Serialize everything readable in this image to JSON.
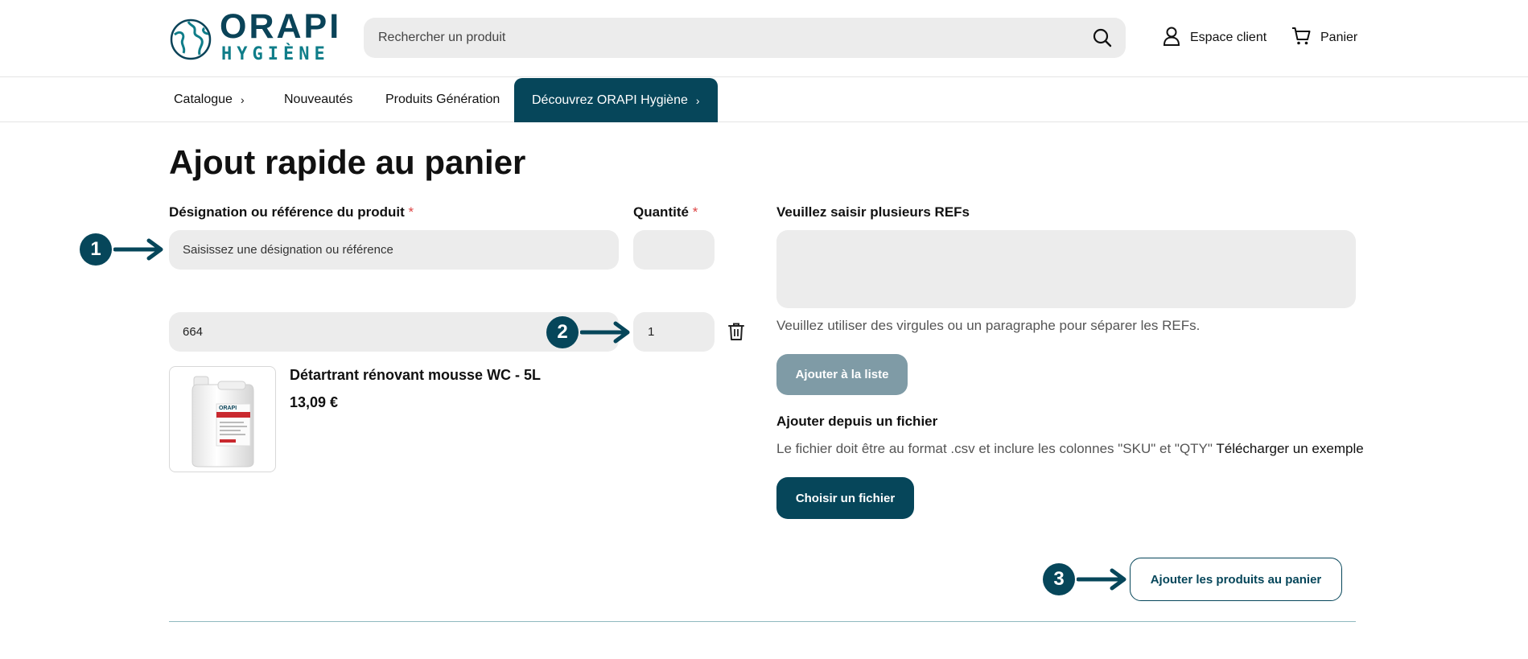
{
  "header": {
    "logo_top": "ORAPI",
    "logo_bottom": "HYGIÈNE",
    "search_placeholder": "Rechercher un produit",
    "account_label": "Espace client",
    "cart_label": "Panier"
  },
  "nav": {
    "items": [
      {
        "label": "Catalogue",
        "chevron": "›"
      },
      {
        "label": "Nouveautés"
      },
      {
        "label": "Produits Génération"
      },
      {
        "label": "Découvrez ORAPI Hygiène",
        "chevron": "›"
      }
    ]
  },
  "main": {
    "title": "Ajout rapide au panier",
    "designation_label": "Désignation ou référence du produit",
    "quantity_label": "Quantité",
    "required_mark": "*",
    "designation_placeholder": "Saisissez une désignation ou référence",
    "quantity_value": "",
    "row": {
      "reference": "664",
      "quantity": "1",
      "product_name": "Détartrant rénovant mousse WC - 5L",
      "price": "13,09 €"
    },
    "multi_refs_label": "Veuillez saisir plusieurs REFs",
    "multi_refs_value": "",
    "multi_refs_help": "Veuillez utiliser des virgules ou un paragraphe pour séparer les REFs.",
    "add_to_list_button": "Ajouter à la liste",
    "file_section_title": "Ajouter depuis un fichier",
    "file_help": "Le fichier doit être au format .csv et inclure les colonnes \"SKU\" et \"QTY\"",
    "file_example_link": "Télécharger un exemple",
    "choose_file_button": "Choisir un fichier",
    "add_to_cart_button": "Ajouter les produits au panier"
  },
  "annotations": [
    "1",
    "2",
    "3"
  ],
  "colors": {
    "brand_dark": "#06465a",
    "brand_teal": "#0f7d89",
    "disabled_button": "#7f9ba6",
    "field_bg": "#ececec",
    "required": "#dd4444"
  },
  "icons": [
    "globe-logo-icon",
    "search-icon",
    "user-icon",
    "cart-icon",
    "chevron-right-icon",
    "trash-icon",
    "arrow-right-icon"
  ]
}
